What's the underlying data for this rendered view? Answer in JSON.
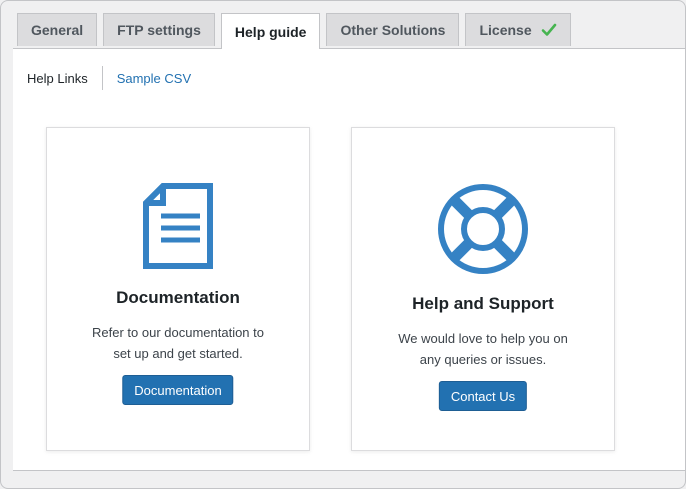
{
  "tabs": [
    {
      "label": "General",
      "active": false
    },
    {
      "label": "FTP settings",
      "active": false
    },
    {
      "label": "Help guide",
      "active": true
    },
    {
      "label": "Other Solutions",
      "active": false
    },
    {
      "label": "License",
      "active": false,
      "badge_icon": "check-icon",
      "badge_color": "#46b450"
    }
  ],
  "subnav": {
    "help_links": "Help Links",
    "sample_csv": "Sample CSV"
  },
  "cards": {
    "documentation": {
      "icon": "document-icon",
      "title": "Documentation",
      "line1": "Refer to our documentation to",
      "line2": "set up and get started.",
      "button": "Documentation"
    },
    "support": {
      "icon": "lifebuoy-icon",
      "title": "Help and Support",
      "line1": "We would love to help you on",
      "line2": "any queries or issues.",
      "button": "Contact Us"
    }
  },
  "colors": {
    "accent": "#2271b1",
    "icon": "#3582c4",
    "success": "#46b450"
  }
}
